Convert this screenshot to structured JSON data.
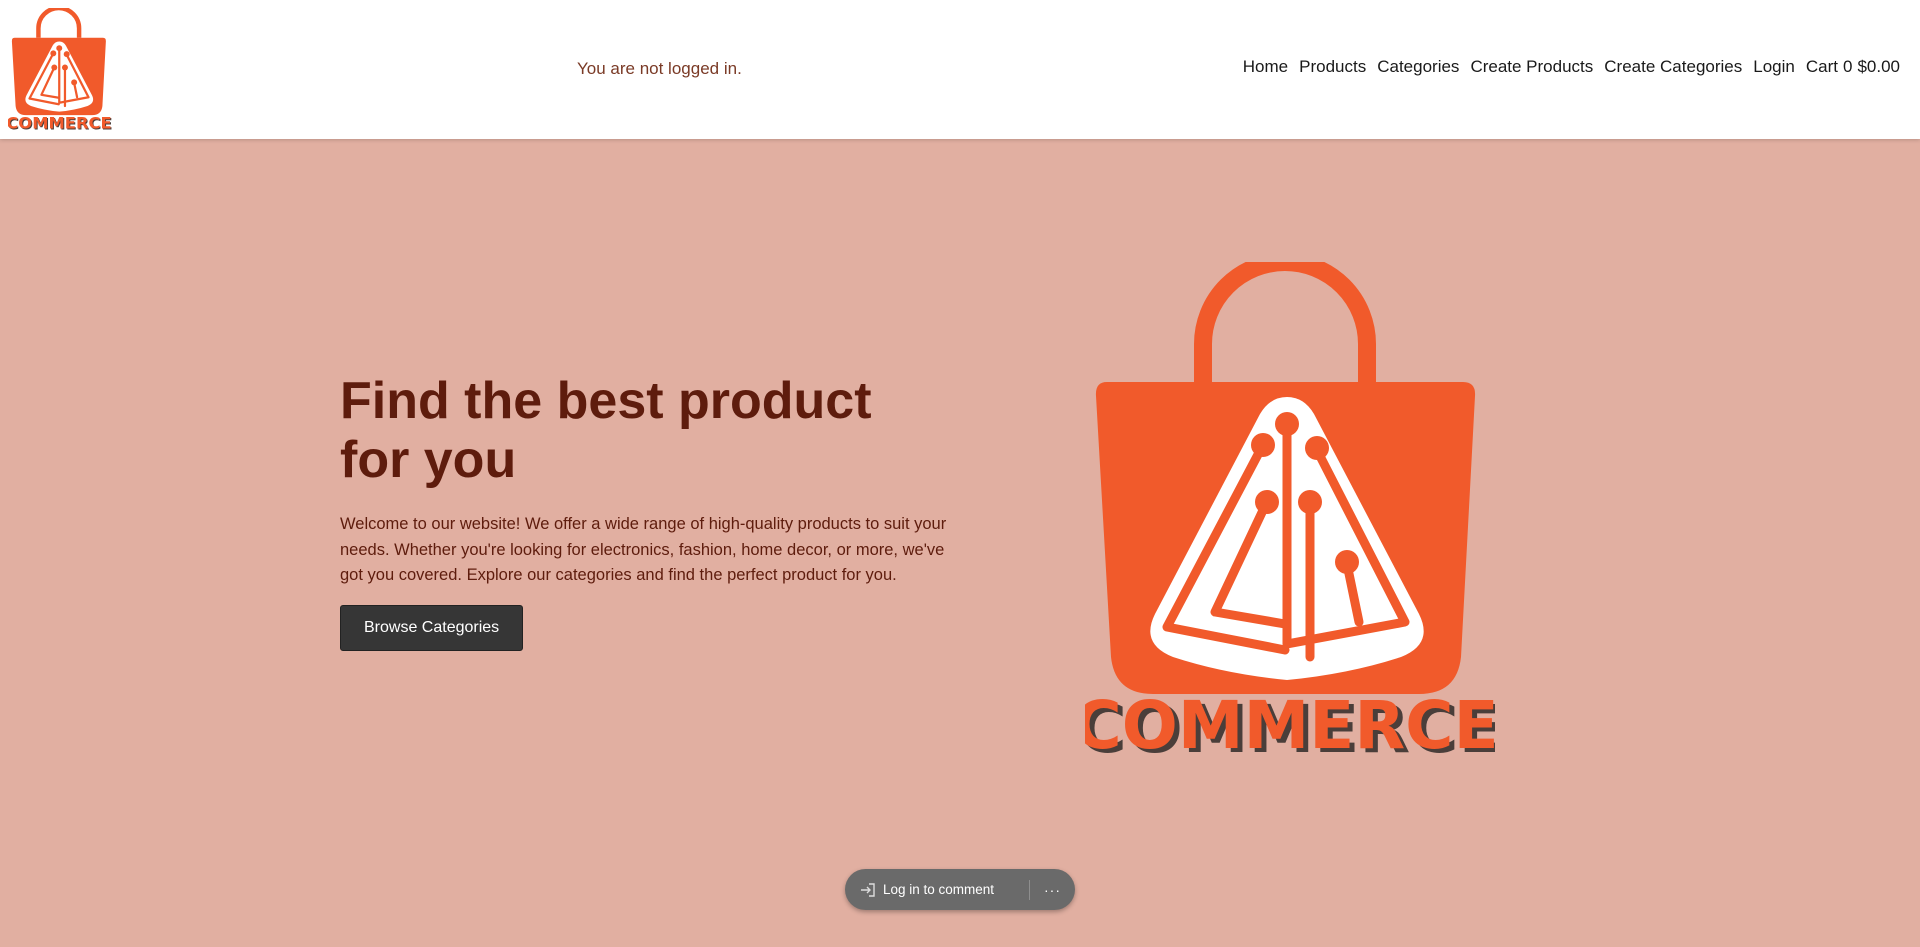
{
  "header": {
    "login_status": "You are not logged in.",
    "nav": {
      "home": "Home",
      "products": "Products",
      "categories": "Categories",
      "create_products": "Create Products",
      "create_categories": "Create Categories",
      "login": "Login",
      "cart_label": "Cart",
      "cart_count": "0",
      "cart_total": "$0.00"
    }
  },
  "hero": {
    "title": "Find the best product for you",
    "description": "Welcome to our website! We offer a wide range of high-quality products to suit your needs. Whether you're looking for electronics, fashion, home decor, or more, we've got you covered. Explore our categories and find the perfect product for you.",
    "button_label": "Browse Categories"
  },
  "logo": {
    "wordmark": "COMMERCE",
    "brand_color": "#f15a2b",
    "shadow_color": "#4a3e3a"
  },
  "comment_bar": {
    "login_label": "Log in to comment",
    "more_label": "···"
  },
  "colors": {
    "page_background": "#e1afa1",
    "heading": "#5e1c0d",
    "button_background": "#363636"
  }
}
